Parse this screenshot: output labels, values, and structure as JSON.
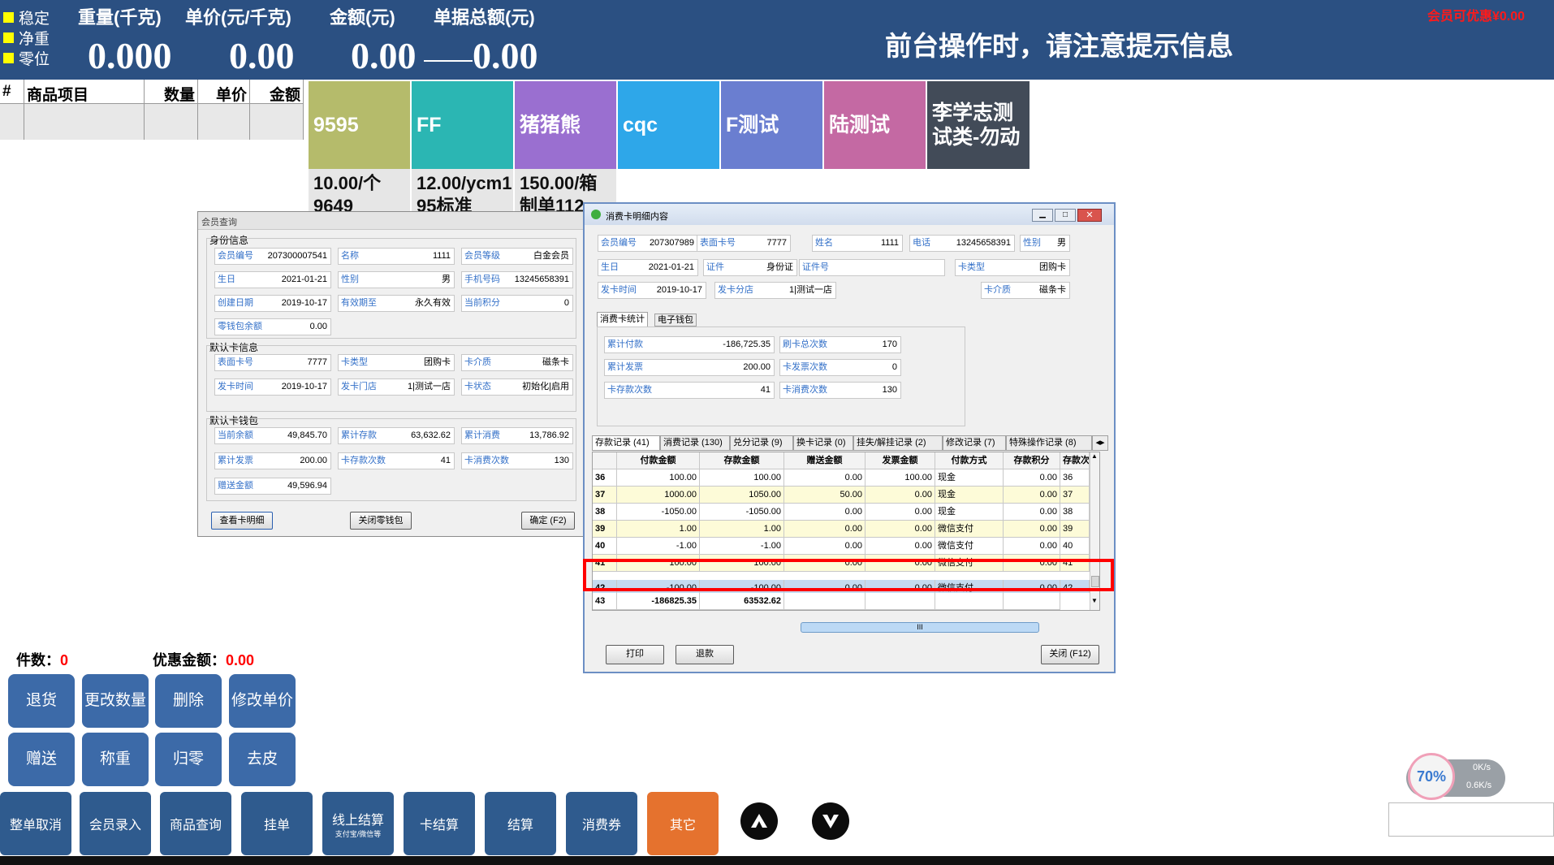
{
  "top": {
    "indicators": [
      "稳定",
      "净重",
      "零位"
    ],
    "headers": {
      "weight": "重量(千克)",
      "unit_price": "单价(元/千克)",
      "amount": "金额(元)",
      "total": "单据总额(元)"
    },
    "values": {
      "weight": "0.000",
      "unit_price": "0.00",
      "amount": "0.00",
      "total": "0.00"
    },
    "notice": "前台操作时，请注意提示信息",
    "member_discount": "会员可优惠¥0.00",
    "colors": {
      "bar": "#2b5082",
      "indicator": "#ffff00",
      "discount": "#ff1a1a"
    }
  },
  "product_table": {
    "headers": [
      "#",
      "商品项目",
      "数量",
      "单价",
      "金额"
    ]
  },
  "tiles": [
    {
      "label": "9595",
      "color": "#b5bb6b",
      "price": "10.00/个",
      "code": "9649"
    },
    {
      "label": "FF",
      "color": "#2bb6b3",
      "price": "12.00/ycm1",
      "code": "95标准"
    },
    {
      "label": "猪猪熊",
      "color": "#9a6fd0",
      "price": "150.00/箱",
      "code": "制单112"
    },
    {
      "label": "cqc",
      "color": "#2ea7e9",
      "price": "",
      "code": ""
    },
    {
      "label": "F测试",
      "color": "#6a7ed0",
      "price": "",
      "code": ""
    },
    {
      "label": "陆测试",
      "color": "#c469a3",
      "price": "",
      "code": ""
    },
    {
      "label": "李学志测试类-勿动",
      "color": "#424b58",
      "price": "",
      "code": ""
    }
  ],
  "member_dialog": {
    "title": "会员查询",
    "sec_identity": "身份信息",
    "sec_card": "默认卡信息",
    "sec_wallet": "默认卡钱包",
    "identity": [
      {
        "k": "会员编号",
        "v": "207300007541"
      },
      {
        "k": "名称",
        "v": "1111"
      },
      {
        "k": "会员等级",
        "v": "白金会员"
      },
      {
        "k": "生日",
        "v": "2021-01-21"
      },
      {
        "k": "性别",
        "v": "男"
      },
      {
        "k": "手机号码",
        "v": "13245658391"
      },
      {
        "k": "创建日期",
        "v": "2019-10-17"
      },
      {
        "k": "有效期至",
        "v": "永久有效"
      },
      {
        "k": "当前积分",
        "v": "0"
      },
      {
        "k": "零钱包余额",
        "v": "0.00"
      }
    ],
    "card": [
      {
        "k": "表面卡号",
        "v": "7777"
      },
      {
        "k": "卡类型",
        "v": "团购卡"
      },
      {
        "k": "卡介质",
        "v": "磁条卡"
      },
      {
        "k": "发卡时间",
        "v": "2019-10-17"
      },
      {
        "k": "发卡门店",
        "v": "1|测试一店"
      },
      {
        "k": "卡状态",
        "v": "初始化|启用"
      }
    ],
    "wallet": [
      {
        "k": "当前余额",
        "v": "49,845.70"
      },
      {
        "k": "累计存款",
        "v": "63,632.62"
      },
      {
        "k": "累计消费",
        "v": "13,786.92"
      },
      {
        "k": "累计发票",
        "v": "200.00"
      },
      {
        "k": "卡存款次数",
        "v": "41"
      },
      {
        "k": "卡消费次数",
        "v": "130"
      },
      {
        "k": "赠送金额",
        "v": "49,596.94"
      }
    ],
    "buttons": {
      "detail": "查看卡明细",
      "close_wallet": "关闭零钱包",
      "confirm": "确定 (F2)"
    }
  },
  "card_dialog": {
    "title": "消费卡明细内容",
    "info": [
      {
        "k": "会员编号",
        "v": "207307989"
      },
      {
        "k": "表面卡号",
        "v": "7777"
      },
      {
        "k": "姓名",
        "v": "1111"
      },
      {
        "k": "电话",
        "v": "13245658391"
      },
      {
        "k": "性别",
        "v": "男"
      },
      {
        "k": "生日",
        "v": "2021-01-21"
      },
      {
        "k": "证件",
        "v": "身份证"
      },
      {
        "k": "证件号",
        "v": ""
      },
      {
        "k": "卡类型",
        "v": "团购卡"
      },
      {
        "k": "发卡时间",
        "v": "2019-10-17"
      },
      {
        "k": "发卡分店",
        "v": "1|测试一店"
      },
      {
        "k": "卡介质",
        "v": "磁条卡"
      }
    ],
    "subtabs": [
      "消费卡统计",
      "电子钱包"
    ],
    "stats": [
      {
        "k": "累计付款",
        "v": "-186,725.35"
      },
      {
        "k": "刷卡总次数",
        "v": "170"
      },
      {
        "k": "累计发票",
        "v": "200.00"
      },
      {
        "k": "卡发票次数",
        "v": "0"
      },
      {
        "k": "卡存款次数",
        "v": "41"
      },
      {
        "k": "卡消费次数",
        "v": "130"
      }
    ],
    "tabs": [
      "存款记录 (41)",
      "消费记录 (130)",
      "兑分记录 (9)",
      "换卡记录 (0)",
      "挂失/解挂记录 (2)",
      "修改记录 (7)",
      "特殊操作记录 (8)"
    ],
    "columns": [
      "付款金额",
      "存款金额",
      "赠送金额",
      "发票金额",
      "付款方式",
      "存款积分",
      "存款次"
    ],
    "rows": [
      {
        "n": "36",
        "c": [
          "100.00",
          "100.00",
          "0.00",
          "100.00",
          "现金",
          "0.00",
          "36"
        ]
      },
      {
        "n": "37",
        "c": [
          "1000.00",
          "1050.00",
          "50.00",
          "0.00",
          "现金",
          "0.00",
          "37"
        ]
      },
      {
        "n": "38",
        "c": [
          "-1050.00",
          "-1050.00",
          "0.00",
          "0.00",
          "现金",
          "0.00",
          "38"
        ]
      },
      {
        "n": "39",
        "c": [
          "1.00",
          "1.00",
          "0.00",
          "0.00",
          "微信支付",
          "0.00",
          "39"
        ]
      },
      {
        "n": "40",
        "c": [
          "-1.00",
          "-1.00",
          "0.00",
          "0.00",
          "微信支付",
          "0.00",
          "40"
        ]
      },
      {
        "n": "41",
        "c": [
          "100.00",
          "100.00",
          "0.00",
          "0.00",
          "微信支付",
          "0.00",
          "41"
        ]
      },
      {
        "n": "42",
        "c": [
          "-100.00",
          "-100.00",
          "0.00",
          "0.00",
          "微信支付",
          "0.00",
          "42"
        ]
      }
    ],
    "total": {
      "n": "43",
      "pay": "-186825.35",
      "deposit": "63532.62"
    },
    "buttons": {
      "print": "打印",
      "refund": "退款",
      "close": "关闭 (F12)"
    },
    "highlight_color": "#ff0000"
  },
  "summary": {
    "count_label": "件数：",
    "count": "0",
    "discount_label": "优惠金额：",
    "discount": "0.00"
  },
  "func_buttons": [
    "退货",
    "更改数量",
    "删除",
    "修改单价",
    "赠送",
    "称重",
    "归零",
    "去皮"
  ],
  "bottom_buttons": [
    {
      "label": "整单取消",
      "sub": ""
    },
    {
      "label": "会员录入",
      "sub": ""
    },
    {
      "label": "商品查询",
      "sub": ""
    },
    {
      "label": "挂单",
      "sub": ""
    },
    {
      "label": "线上结算",
      "sub": "支付宝/微信等"
    },
    {
      "label": "卡结算",
      "sub": ""
    },
    {
      "label": "结算",
      "sub": ""
    },
    {
      "label": "消费券",
      "sub": ""
    },
    {
      "label": "其它",
      "sub": ""
    }
  ],
  "net_widget": {
    "percent": "70%",
    "up": "0K/s",
    "down": "0.6K/s"
  }
}
